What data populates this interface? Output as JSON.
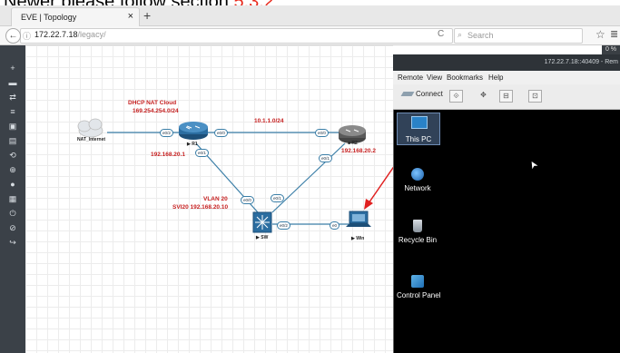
{
  "caption": {
    "text": "Newer please follow section ",
    "highlight": "5.3.2"
  },
  "browser": {
    "tab_title": "EVE | Topology",
    "tab_close": "×",
    "new_tab": "+",
    "back": "←",
    "info_icon": "ⓘ",
    "url_host": "172.22.7.18",
    "url_path": "/legacy/",
    "reload": "C",
    "search_placeholder": "Search",
    "search_icon": "⌕",
    "star_icon": "☆",
    "library_icon": "≣"
  },
  "sidebar": {
    "items": [
      "+",
      "▬",
      "⇄",
      "≡",
      "▣",
      "▤",
      "⟲",
      "⊕",
      "●",
      "▦",
      "⏻",
      "⊘",
      "↪"
    ]
  },
  "topology": {
    "cloud_title": "DHCP NAT Cloud",
    "cloud_subnet": "169.254.254.0/24",
    "link_r1_r2": "10.1.1.0/24",
    "r1_ip": "192.168.20.1",
    "r2_ip": "192.168.20.2",
    "vlan": "VLAN 20",
    "svi": "SVI20 192.168.20.10",
    "nodes": {
      "nat": "NAT_Internet",
      "r1": "▶ R1",
      "r2": "■ R2",
      "sw": "▶ SW",
      "win": "▶ Win"
    },
    "ports": {
      "r1_e02": "e0/2",
      "r1_e00": "e0/0",
      "r1_e01": "e0/1",
      "r2_e00": "e0/0",
      "r2_e01": "e0/1",
      "sw_e00": "e0/0",
      "sw_e01": "e0/1",
      "sw_e02": "e0/2",
      "win_e0": "e0"
    }
  },
  "remote": {
    "title": "172.22.7.18::40409 - Rem",
    "zoom": "0 %",
    "menu": [
      "Remote",
      "View",
      "Bookmarks",
      "Help"
    ],
    "connect_label": "Connect",
    "tools": [
      "⟐",
      "✥",
      "⊟",
      "⊡"
    ],
    "desktop_icons": [
      "This PC",
      "Network",
      "Recycle Bin",
      "Control Panel"
    ],
    "cursor": "➤"
  },
  "colors": {
    "annotation_red": "#c62020",
    "arrow_red": "#e02020",
    "link_blue": "#3a7ea7",
    "sidebar": "#3b4148"
  }
}
